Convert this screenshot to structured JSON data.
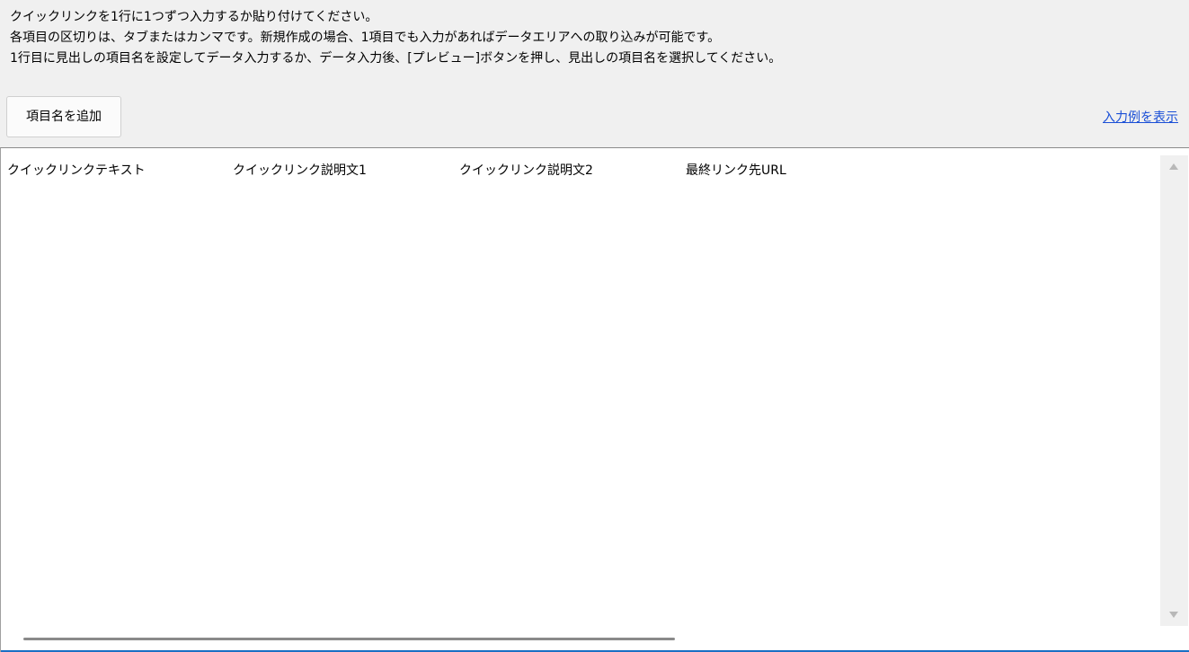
{
  "instructions": {
    "line1": "クイックリンクを1行に1つずつ入力するか貼り付けてください。",
    "line2": "各項目の区切りは、タブまたはカンマです。新規作成の場合、1項目でも入力があればデータエリアへの取り込みが可能です。",
    "line3": "1行目に見出しの項目名を設定してデータ入力するか、データ入力後、[プレビュー]ボタンを押し、見出しの項目名を選択してください。"
  },
  "toolbar": {
    "add_field_label": "項目名を追加",
    "show_example_label": "入力例を表示"
  },
  "editor": {
    "header_columns": [
      "クイックリンクテキスト",
      "クイックリンク説明文1",
      "クイックリンク説明文2",
      "最終リンク先URL"
    ]
  },
  "colors": {
    "link": "#1a4fd6",
    "focus_border": "#1a6fc4",
    "background": "#f0f0f0"
  },
  "icons": {
    "scroll_up": "scroll-up-arrow-icon",
    "scroll_down": "scroll-down-arrow-icon"
  }
}
